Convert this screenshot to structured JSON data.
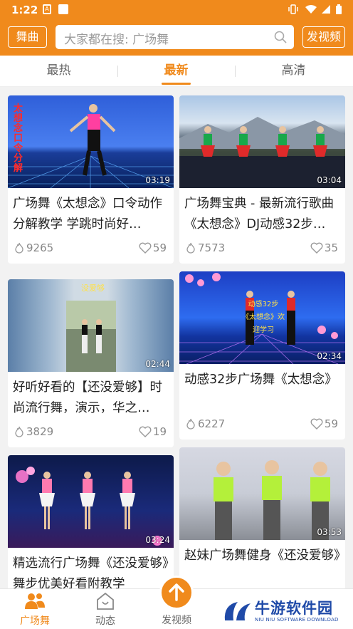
{
  "status": {
    "time": "1:22"
  },
  "header": {
    "left_button": "舞曲",
    "search_placeholder": "大家都在搜: 广场舞",
    "right_button": "发视频"
  },
  "tabs": [
    {
      "label": "最热"
    },
    {
      "label": "最新"
    },
    {
      "label": "高清"
    }
  ],
  "videos": [
    {
      "title": "广场舞《太想念》口令动作分解教学 学跳时尚好…",
      "duration": "03:19",
      "likes": "9265",
      "hearts": "59",
      "overlay": "太想念口令分解"
    },
    {
      "title": "广场舞宝典 - 最新流行歌曲《太想念》DJ动感32步…",
      "duration": "03:04",
      "likes": "7573",
      "hearts": "35"
    },
    {
      "title": "好听好看的【还没爱够】时尚流行舞，演示，华之…",
      "duration": "02:44",
      "likes": "3829",
      "hearts": "19",
      "overlay": "没爱够"
    },
    {
      "title": "动感32步广场舞《太想念》",
      "duration": "02:34",
      "likes": "6227",
      "hearts": "59",
      "overlay": "动感32步《太想念》欢迎学习"
    },
    {
      "title": "精选流行广场舞《还没爱够》舞步优美好看附教学",
      "duration": "03:24"
    },
    {
      "title": "赵妹广场舞健身《还没爱够》",
      "duration": "03:53"
    }
  ],
  "bottom_nav": [
    {
      "label": "广场舞"
    },
    {
      "label": "动态"
    },
    {
      "label": "发视频"
    }
  ],
  "watermark": {
    "title": "牛游软件园",
    "subtitle": "NIU NIU SOFTWARE DOWNLOAD"
  },
  "colors": {
    "accent": "#f08a1c"
  }
}
